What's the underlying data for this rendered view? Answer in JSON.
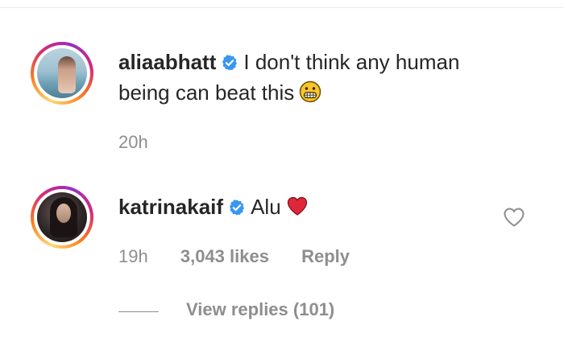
{
  "comments": [
    {
      "username": "aliaabhatt",
      "text_line1": "I don't think any human",
      "text_line2": "being can beat this",
      "emoji": "grimacing-face",
      "time": "20h"
    },
    {
      "username": "katrinakaif",
      "text": "Alu",
      "emoji": "red-heart",
      "time": "19h",
      "likes": "3,043 likes",
      "reply": "Reply",
      "view_replies": "View replies (101)"
    }
  ],
  "colors": {
    "text": "#262626",
    "muted": "#8e8e8e",
    "verified": "#3897f0",
    "heart": "#e0263b"
  },
  "icons": [
    "verified-badge-icon",
    "grimacing-emoji-icon",
    "red-heart-emoji-icon",
    "like-heart-icon"
  ]
}
